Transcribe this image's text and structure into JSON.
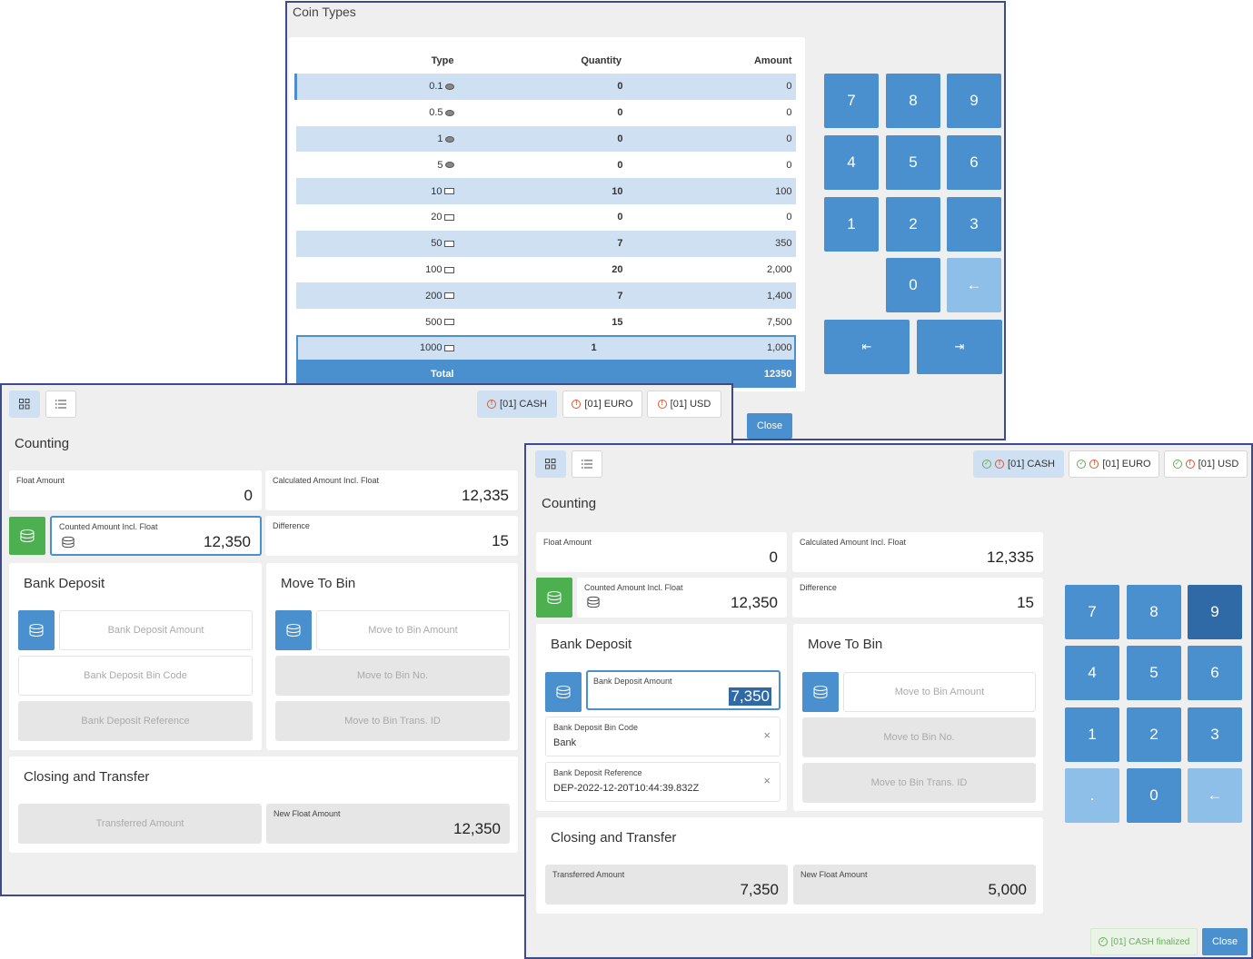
{
  "coin_dialog": {
    "title": "Coin Types",
    "columns": [
      "Type",
      "Quantity",
      "Amount"
    ],
    "rows": [
      {
        "type": "0.1",
        "icon": "coin",
        "qty": "0",
        "amount": "0"
      },
      {
        "type": "0.5",
        "icon": "coin",
        "qty": "0",
        "amount": "0"
      },
      {
        "type": "1",
        "icon": "coin",
        "qty": "0",
        "amount": "0"
      },
      {
        "type": "5",
        "icon": "coin",
        "qty": "0",
        "amount": "0"
      },
      {
        "type": "10",
        "icon": "bill",
        "qty": "10",
        "amount": "100"
      },
      {
        "type": "20",
        "icon": "bill",
        "qty": "0",
        "amount": "0"
      },
      {
        "type": "50",
        "icon": "bill",
        "qty": "7",
        "amount": "350"
      },
      {
        "type": "100",
        "icon": "bill",
        "qty": "20",
        "amount": "2,000"
      },
      {
        "type": "200",
        "icon": "bill",
        "qty": "7",
        "amount": "1,400"
      },
      {
        "type": "500",
        "icon": "bill",
        "qty": "15",
        "amount": "7,500"
      },
      {
        "type": "1000",
        "icon": "bill",
        "qty": "1",
        "amount": "1,000"
      }
    ],
    "total_label": "Total",
    "total_value": "12350",
    "keypad": [
      "7",
      "8",
      "9",
      "4",
      "5",
      "6",
      "1",
      "2",
      "3",
      "0",
      "←",
      "⇤",
      "⇥"
    ],
    "close_label": "Close"
  },
  "left_window": {
    "tabs": [
      "[01] CASH",
      "[01] EURO",
      "[01] USD"
    ],
    "counting_title": "Counting",
    "float_amount_label": "Float Amount",
    "float_amount_value": "0",
    "calc_label": "Calculated Amount Incl. Float",
    "calc_value": "12,335",
    "counted_label": "Counted Amount Incl. Float",
    "counted_value": "12,350",
    "difference_label": "Difference",
    "difference_value": "15",
    "bank_deposit_title": "Bank Deposit",
    "bank_deposit_amount_placeholder": "Bank Deposit Amount",
    "bank_deposit_bin_code_placeholder": "Bank Deposit Bin Code",
    "bank_deposit_reference_placeholder": "Bank Deposit Reference",
    "move_to_bin_title": "Move To Bin",
    "move_to_bin_amount_placeholder": "Move to Bin Amount",
    "move_to_bin_no_placeholder": "Move to Bin No.",
    "move_to_bin_trans_placeholder": "Move to Bin Trans. ID",
    "closing_title": "Closing and Transfer",
    "transferred_placeholder": "Transferred Amount",
    "new_float_label": "New Float Amount",
    "new_float_value": "12,350"
  },
  "right_window": {
    "tabs": [
      "[01] CASH",
      "[01] EURO",
      "[01] USD"
    ],
    "counting_title": "Counting",
    "float_amount_label": "Float Amount",
    "float_amount_value": "0",
    "calc_label": "Calculated Amount Incl. Float",
    "calc_value": "12,335",
    "counted_label": "Counted Amount Incl. Float",
    "counted_value": "12,350",
    "difference_label": "Difference",
    "difference_value": "15",
    "bank_deposit_title": "Bank Deposit",
    "bank_deposit_amount_label": "Bank Deposit Amount",
    "bank_deposit_amount_value": "7,350",
    "bank_deposit_bin_code_label": "Bank Deposit Bin Code",
    "bank_deposit_bin_code_value": "Bank",
    "bank_deposit_reference_label": "Bank Deposit Reference",
    "bank_deposit_reference_value": "DEP-2022-12-20T10:44:39.832Z",
    "move_to_bin_title": "Move To Bin",
    "move_to_bin_amount_placeholder": "Move to Bin Amount",
    "move_to_bin_no_placeholder": "Move to Bin No.",
    "move_to_bin_trans_placeholder": "Move to Bin Trans. ID",
    "closing_title": "Closing and Transfer",
    "transferred_label": "Transferred Amount",
    "transferred_value": "7,350",
    "new_float_label": "New Float Amount",
    "new_float_value": "5,000",
    "keypad": [
      "7",
      "8",
      "9",
      "4",
      "5",
      "6",
      "1",
      "2",
      "3",
      ".",
      "0",
      "←"
    ],
    "status_label": "[01] CASH finalized",
    "close_label": "Close"
  }
}
